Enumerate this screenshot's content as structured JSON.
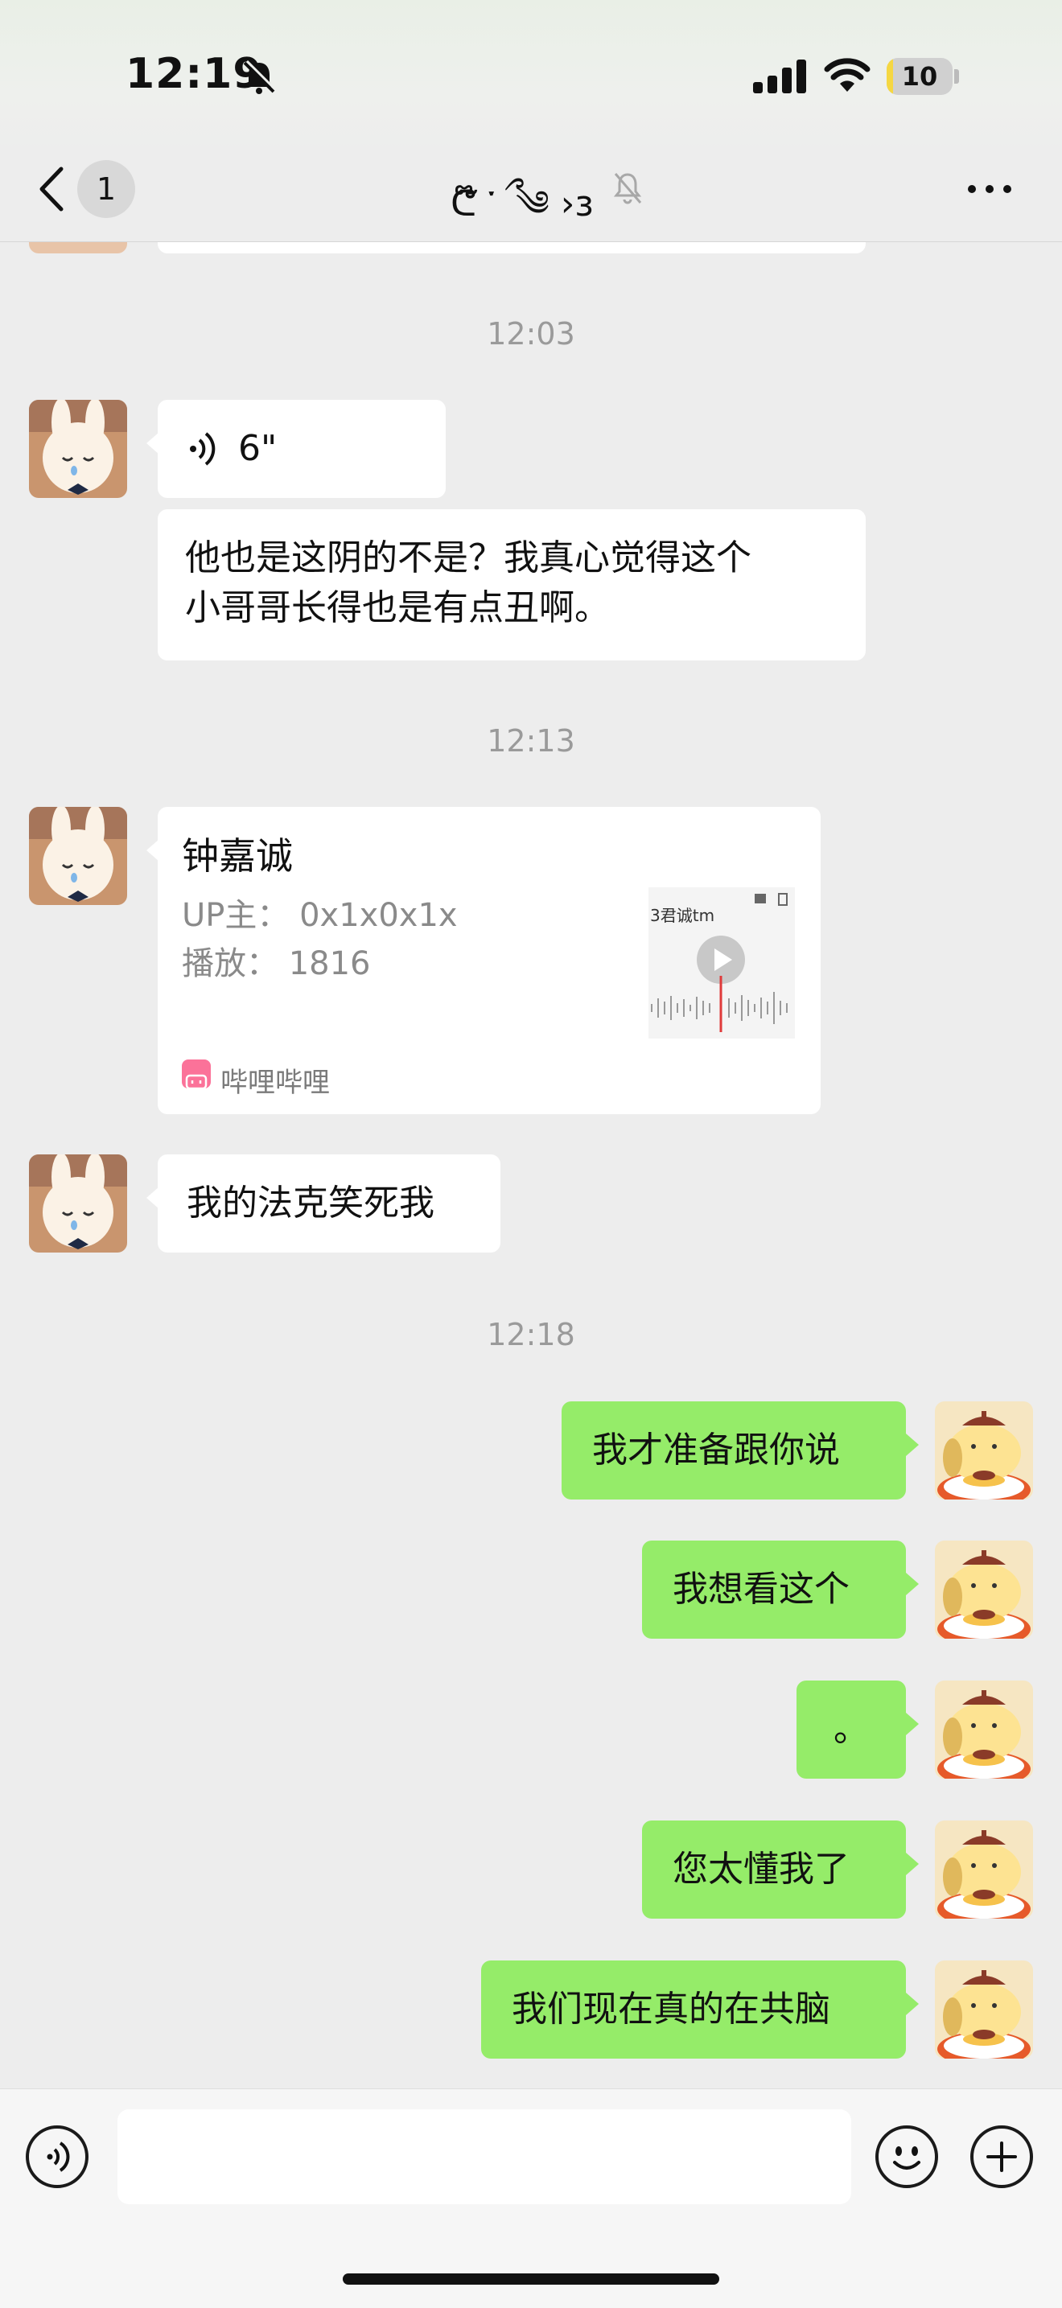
{
  "status_bar": {
    "time": "12:19",
    "battery_level": "10",
    "battery_fraction": 0.1
  },
  "nav": {
    "unread_count": "1",
    "chat_title": "ᕦ໊ ་ ྀ ༄ ›ɜ",
    "icons": [
      "back-chevron-icon",
      "muted-bell-icon",
      "more-dots-icon"
    ]
  },
  "messages": [
    {
      "type": "timestamp",
      "text": "12:03"
    },
    {
      "type": "voice",
      "side": "left",
      "duration": "6\""
    },
    {
      "type": "text",
      "side": "left",
      "lines": [
        "他也是这阴的不是？我真心觉得这个",
        "小哥哥长得也是有点丑啊。"
      ]
    },
    {
      "type": "timestamp",
      "text": "12:13"
    },
    {
      "type": "video_card",
      "side": "left",
      "title": "钟嘉诚",
      "uploader_line": "UP主：  0x1x0x1x",
      "plays_line": "播放：  1816",
      "source": "哔哩哔哩",
      "thumb_text": "3君诚tm"
    },
    {
      "type": "text",
      "side": "left",
      "lines": [
        "我的法克笑死我"
      ]
    },
    {
      "type": "timestamp",
      "text": "12:18"
    },
    {
      "type": "text",
      "side": "right",
      "lines": [
        "我才准备跟你说"
      ]
    },
    {
      "type": "text",
      "side": "right",
      "lines": [
        "我想看这个"
      ]
    },
    {
      "type": "text",
      "side": "right",
      "lines": [
        "。"
      ]
    },
    {
      "type": "text",
      "side": "right",
      "lines": [
        "您太懂我了"
      ]
    },
    {
      "type": "text",
      "side": "right",
      "lines": [
        "我们现在真的在共脑"
      ]
    }
  ],
  "input_bar": {
    "icons": [
      "voice-mode-icon",
      "emoji-icon",
      "plus-icon"
    ],
    "input_value": ""
  },
  "colors": {
    "chat_background": "#ededed",
    "sent_bubble": "#95ec69",
    "received_bubble": "#ffffff",
    "timestamp_text": "#9a9a9a",
    "bilibili_pink": "#fb7299",
    "battery_yellow": "#f5d742"
  }
}
